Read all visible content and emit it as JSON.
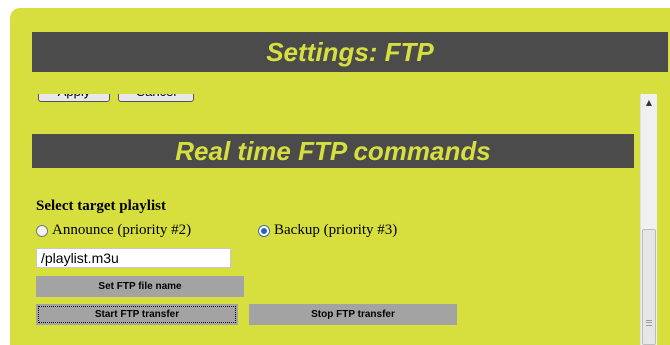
{
  "header": {
    "title": "Settings: FTP"
  },
  "top_buttons": {
    "apply_label": "Apply",
    "cancel_label": "Cancel"
  },
  "section": {
    "title": "Real time FTP commands"
  },
  "playlist": {
    "label": "Select target playlist",
    "options": [
      {
        "label": "Announce (priority #2)",
        "checked": false
      },
      {
        "label": "Backup (priority #3)",
        "checked": true
      }
    ],
    "filename_value": "/playlist.m3u"
  },
  "buttons": {
    "set_name": "Set FTP file name",
    "start": "Start FTP transfer",
    "stop": "Stop FTP transfer"
  },
  "colors": {
    "background": "#d7df3f",
    "banner": "#4b4b4b",
    "button": "#a3a3a3"
  },
  "icons": {
    "scroll_up": "triangle-up",
    "scroll_grip": "grip-lines"
  }
}
